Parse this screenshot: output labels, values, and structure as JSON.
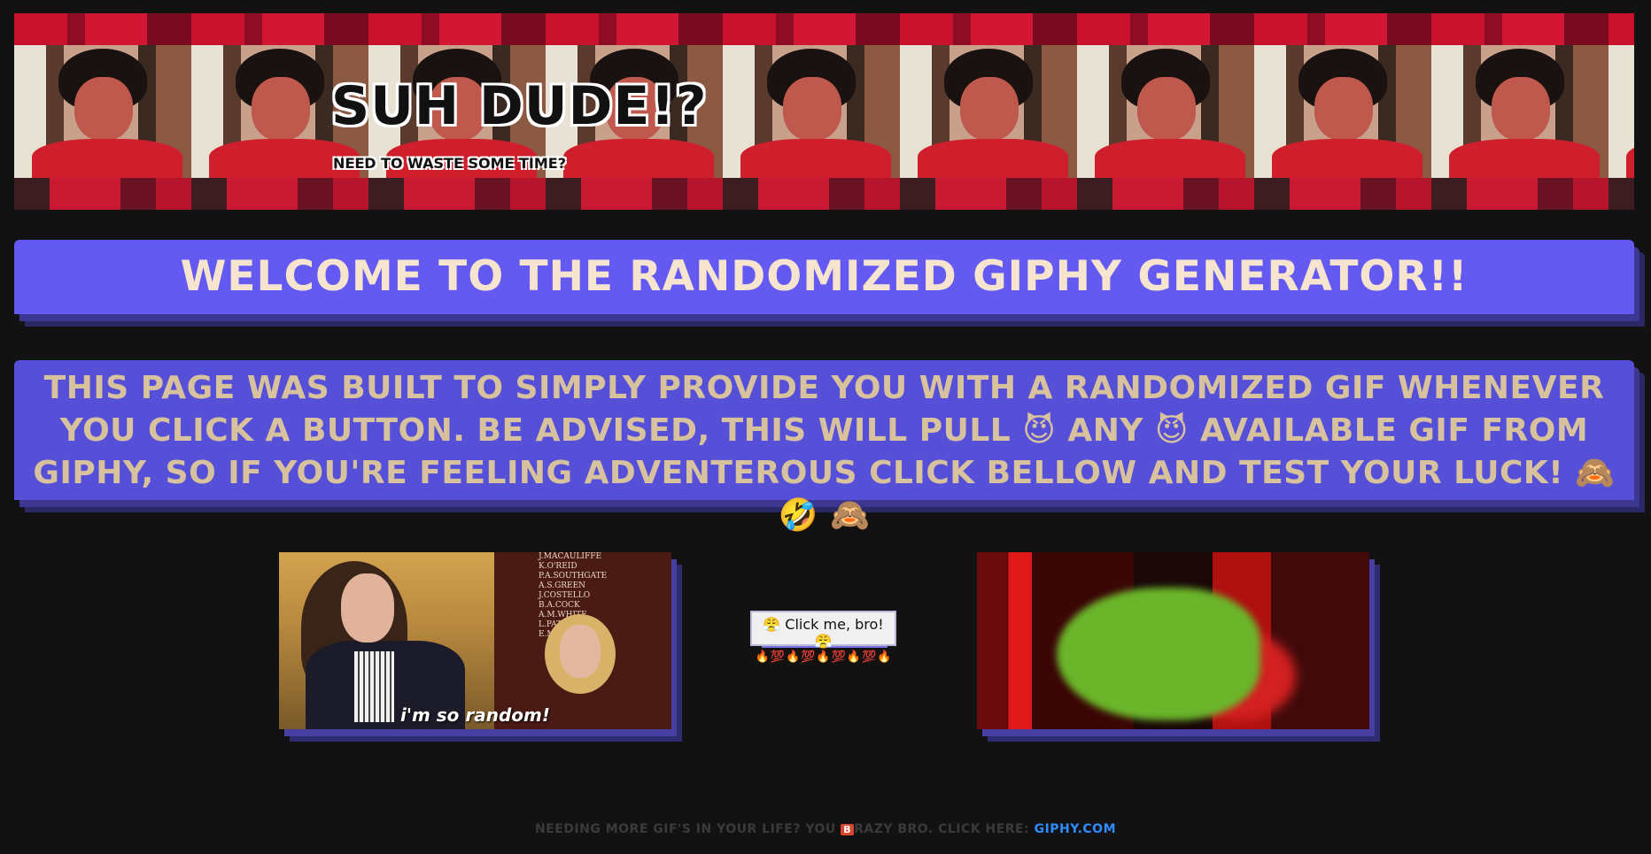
{
  "header": {
    "title": "SUH DUDE!?",
    "subtitle": "NEED TO WASTE SOME TIME?"
  },
  "welcome": {
    "heading": "WELCOME TO THE RANDOMIZED GIPHY GENERATOR!!"
  },
  "info": {
    "text": "THIS PAGE WAS BUILT TO SIMPLY PROVIDE YOU WITH A RANDOMIZED GIF WHENEVER YOU CLICK A BUTTON. BE ADVISED, THIS WILL PULL 😈 ANY 😈 AVAILABLE GIF FROM GIPHY, SO IF YOU'RE FEELING ADVENTEROUS CLICK BELLOW AND TEST YOUR LUCK! 🙈 🤣 🙈"
  },
  "gifs": {
    "left_caption": "i'm so random!",
    "left_board_lines": [
      "J.MACAULIFFE",
      "K.O'REID",
      "P.A.SOUTHGATE",
      "A.S.GREEN",
      "J.COSTELLO",
      "B.A.COCK",
      "A.M.WHITE",
      "L.PATTERSON",
      "E.MACDONALD"
    ]
  },
  "button": {
    "label": "😤 Click me, bro! 😤",
    "emoji_row": "🔥💯🔥💯🔥💯🔥💯🔥"
  },
  "footer": {
    "lead": "NEEDING MORE GIF'S IN YOUR LIFE? YOU",
    "badge": "B",
    "mid": "RAZY BRO. CLICK HERE:",
    "link": "GIPHY.COM"
  },
  "colors": {
    "page_background": "#121212",
    "panel_purple": "#645af2",
    "heading_text": "#f6e4cf",
    "link_blue": "#2f8cff"
  }
}
